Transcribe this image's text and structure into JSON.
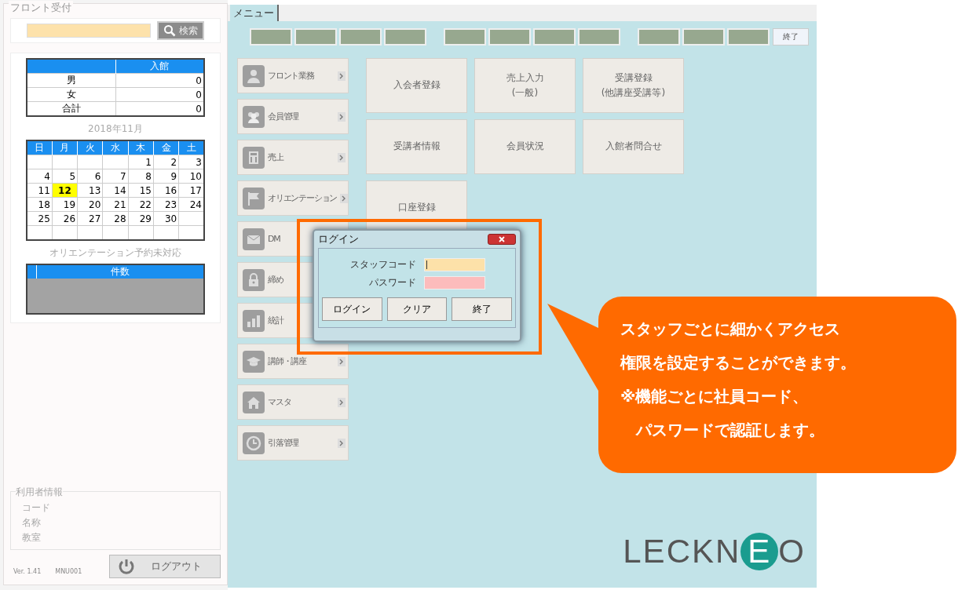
{
  "front_panel": {
    "title": "フロント受付",
    "search_button": "検索",
    "stats_table": {
      "columns": [
        "入館"
      ],
      "rows": [
        {
          "label": "男",
          "value": "0"
        },
        {
          "label": "女",
          "value": "0"
        },
        {
          "label": "合計",
          "value": "0"
        }
      ]
    },
    "calendar": {
      "month": "2018年11月",
      "weekdays": [
        "日",
        "月",
        "火",
        "水",
        "木",
        "金",
        "土"
      ],
      "weeks": [
        [
          {
            "selected": false
          },
          {
            "selected": false
          },
          {
            "selected": false
          },
          {
            "selected": false
          },
          {
            "day": "1",
            "selected": false
          },
          {
            "day": "2",
            "selected": false
          },
          {
            "day": "3",
            "selected": false
          }
        ],
        [
          {
            "day": "4",
            "selected": false
          },
          {
            "day": "5",
            "selected": false
          },
          {
            "day": "6",
            "selected": false
          },
          {
            "day": "7",
            "selected": false
          },
          {
            "day": "8",
            "selected": false
          },
          {
            "day": "9",
            "selected": false
          },
          {
            "day": "10",
            "selected": false
          }
        ],
        [
          {
            "day": "11",
            "selected": false
          },
          {
            "day": "12",
            "selected": true
          },
          {
            "day": "13",
            "selected": false
          },
          {
            "day": "14",
            "selected": false
          },
          {
            "day": "15",
            "selected": false
          },
          {
            "day": "16",
            "selected": false
          },
          {
            "day": "17",
            "selected": false
          }
        ],
        [
          {
            "day": "18",
            "selected": false
          },
          {
            "day": "19",
            "selected": false
          },
          {
            "day": "20",
            "selected": false
          },
          {
            "day": "21",
            "selected": false
          },
          {
            "day": "22",
            "selected": false
          },
          {
            "day": "23",
            "selected": false
          },
          {
            "day": "24",
            "selected": false
          }
        ],
        [
          {
            "day": "25",
            "selected": false
          },
          {
            "day": "26",
            "selected": false
          },
          {
            "day": "27",
            "selected": false
          },
          {
            "day": "28",
            "selected": false
          },
          {
            "day": "29",
            "selected": false
          },
          {
            "day": "30",
            "selected": false
          },
          {
            "selected": false
          }
        ],
        [
          {
            "selected": false
          },
          {
            "selected": false
          },
          {
            "selected": false
          },
          {
            "selected": false
          },
          {
            "selected": false
          },
          {
            "selected": false
          },
          {
            "selected": false
          }
        ]
      ]
    },
    "orientation": {
      "title": "オリエンテーション予約未対応",
      "columns": [
        "件数"
      ]
    },
    "user_info": {
      "title": "利用者情報",
      "fields": [
        "コード",
        "名称",
        "教室"
      ]
    },
    "version": "Ver. 1.41",
    "screen_id": "MNU001",
    "logout_button": "ログアウト"
  },
  "menu_tab": {
    "label": "メニュー",
    "selected": true
  },
  "toolbar": {
    "exit_button": "終了"
  },
  "side_menu": [
    {
      "label": "フロント業務",
      "chevron": true
    },
    {
      "label": "会員管理",
      "chevron": true
    },
    {
      "label": "売上",
      "chevron": true
    },
    {
      "label": "オリエンテーション",
      "chevron": true
    },
    {
      "label": "DM"
    },
    {
      "label": "締め"
    },
    {
      "label": "統計"
    },
    {
      "label": "講師・講座",
      "chevron": true
    },
    {
      "label": "マスタ",
      "chevron": true
    },
    {
      "label": "引落管理",
      "chevron": true
    }
  ],
  "tiles": [
    {
      "lines": [
        "入会者登録"
      ]
    },
    {
      "lines": [
        "売上入力",
        "(一般)"
      ]
    },
    {
      "lines": [
        "受講登録",
        "(他講座受講等)"
      ]
    },
    {
      "lines": [
        "受講者情報"
      ]
    },
    {
      "lines": [
        "会員状況"
      ]
    },
    {
      "lines": [
        "入館者問合せ"
      ]
    },
    {
      "lines": [
        "口座登録"
      ]
    }
  ],
  "logo": {
    "before": "LECKN",
    "mark": "E",
    "after": "O"
  },
  "dialog": {
    "title": "ログイン",
    "fields": [
      {
        "label": "スタッフコード",
        "color": "#fde1a9",
        "focused": true
      },
      {
        "label": "パスワード",
        "color": "#fcbcbc",
        "focused": false
      }
    ],
    "buttons": [
      "ログイン",
      "クリア",
      "終了"
    ]
  },
  "callout": {
    "lines": [
      "スタッフごとに細かくアクセス",
      "権限を設定することができます。",
      "※機能ごとに社員コード、",
      "　パスワードで認証します。"
    ]
  }
}
